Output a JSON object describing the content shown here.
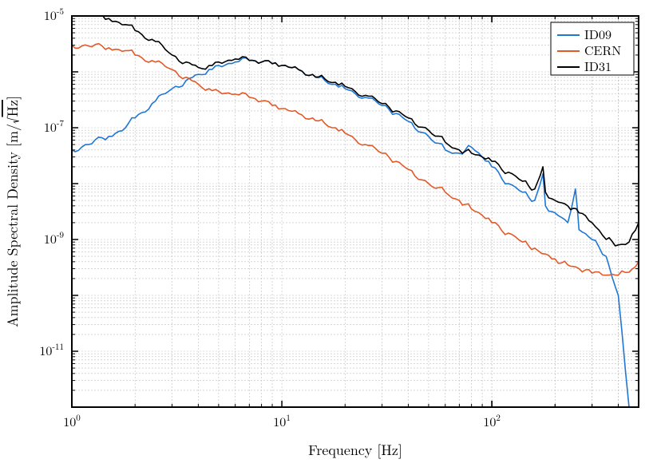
{
  "chart_data": {
    "type": "line",
    "xlabel": "Frequency [Hz]",
    "ylabel": "Amplitude Spectral Density [m/√Hz]",
    "x_scale": "log",
    "y_scale": "log",
    "xlim": [
      1,
      500
    ],
    "ylim": [
      1e-12,
      1e-05
    ],
    "x_ticks": [
      1,
      10,
      100
    ],
    "x_tick_labels": [
      "10^0",
      "10^1",
      "10^2"
    ],
    "y_ticks": [
      1e-11,
      1e-09,
      1e-07,
      1e-05
    ],
    "y_tick_labels": [
      "10^-11",
      "10^-9",
      "10^-7",
      "10^-5"
    ],
    "grid": true,
    "legend_position": "upper right",
    "series": [
      {
        "name": "ID09",
        "color": "#1f77d4",
        "x": [
          1,
          1.2,
          1.5,
          1.8,
          2,
          2.5,
          3,
          3.5,
          4,
          4.5,
          5,
          6,
          7,
          8,
          9,
          10,
          12,
          14,
          16,
          18,
          20,
          25,
          30,
          35,
          40,
          50,
          60,
          70,
          80,
          90,
          100,
          120,
          140,
          160,
          175,
          180,
          200,
          230,
          250,
          260,
          300,
          350,
          400,
          450
        ],
        "y": [
          4e-08,
          5e-08,
          7e-08,
          1e-07,
          1.5e-07,
          3e-07,
          5e-07,
          7e-07,
          9e-07,
          1.1e-06,
          1.3e-06,
          1.5e-06,
          1.6e-06,
          1.5e-06,
          1.4e-06,
          1.3e-06,
          1.1e-06,
          9e-07,
          7e-07,
          6e-07,
          5e-07,
          3.5e-07,
          2.5e-07,
          1.8e-07,
          1.3e-07,
          7e-08,
          4e-08,
          3.5e-08,
          4.5e-08,
          3e-08,
          2e-08,
          1e-08,
          7e-09,
          5e-09,
          1.5e-08,
          4e-09,
          3e-09,
          2e-09,
          8e-09,
          1.5e-09,
          1e-09,
          5e-10,
          1e-10,
          1e-12
        ]
      },
      {
        "name": "CERN",
        "color": "#e15a27",
        "x": [
          1,
          1.2,
          1.5,
          1.8,
          2,
          2.5,
          3,
          3.5,
          4,
          4.5,
          5,
          6,
          7,
          8,
          9,
          10,
          12,
          14,
          16,
          18,
          20,
          25,
          30,
          35,
          40,
          50,
          60,
          70,
          80,
          90,
          100,
          120,
          140,
          160,
          180,
          200,
          230,
          260,
          300,
          350,
          400,
          450,
          500
        ],
        "y": [
          3e-06,
          2.9e-06,
          2.7e-06,
          2.4e-06,
          2e-06,
          1.5e-06,
          1.1e-06,
          8e-07,
          6e-07,
          5e-07,
          4.5e-07,
          4e-07,
          3.5e-07,
          3e-07,
          2.5e-07,
          2.2e-07,
          1.8e-07,
          1.5e-07,
          1.2e-07,
          1e-07,
          8e-08,
          5e-08,
          3.5e-08,
          2.5e-08,
          1.8e-08,
          1e-08,
          7e-09,
          5e-09,
          3.5e-09,
          2.7e-09,
          2e-09,
          1.3e-09,
          9e-10,
          7e-10,
          5.5e-10,
          4.5e-10,
          3.5e-10,
          3e-10,
          2.5e-10,
          2.3e-10,
          2.3e-10,
          2.6e-10,
          4e-10
        ]
      },
      {
        "name": "ID31",
        "color": "#000000",
        "x": [
          1,
          1.2,
          1.5,
          1.8,
          2,
          2.5,
          3,
          3.5,
          4,
          4.5,
          5,
          6,
          7,
          8,
          9,
          10,
          12,
          14,
          16,
          18,
          20,
          25,
          30,
          35,
          40,
          50,
          60,
          70,
          80,
          90,
          100,
          120,
          140,
          160,
          175,
          180,
          200,
          230,
          260,
          300,
          350,
          400,
          450,
          500
        ],
        "y": [
          1.5e-05,
          1.2e-05,
          9e-06,
          7e-06,
          5.5e-06,
          3.5e-06,
          2e-06,
          1.5e-06,
          1.2e-06,
          1.3e-06,
          1.5e-06,
          1.7e-06,
          1.6e-06,
          1.5e-06,
          1.4e-06,
          1.3e-06,
          1.1e-06,
          9e-07,
          7.5e-07,
          6.5e-07,
          5.5e-07,
          3.8e-07,
          2.7e-07,
          2e-07,
          1.5e-07,
          9e-08,
          5.5e-08,
          4e-08,
          3.5e-08,
          3e-08,
          2.5e-08,
          1.6e-08,
          1.1e-08,
          8e-09,
          2e-08,
          7e-09,
          5e-09,
          4e-09,
          3e-09,
          2e-09,
          1e-09,
          8e-10,
          9e-10,
          2e-09
        ]
      }
    ]
  },
  "legend": {
    "items": [
      {
        "label": "ID09",
        "color": "#1f77d4"
      },
      {
        "label": "CERN",
        "color": "#e15a27"
      },
      {
        "label": "ID31",
        "color": "#000000"
      }
    ]
  }
}
